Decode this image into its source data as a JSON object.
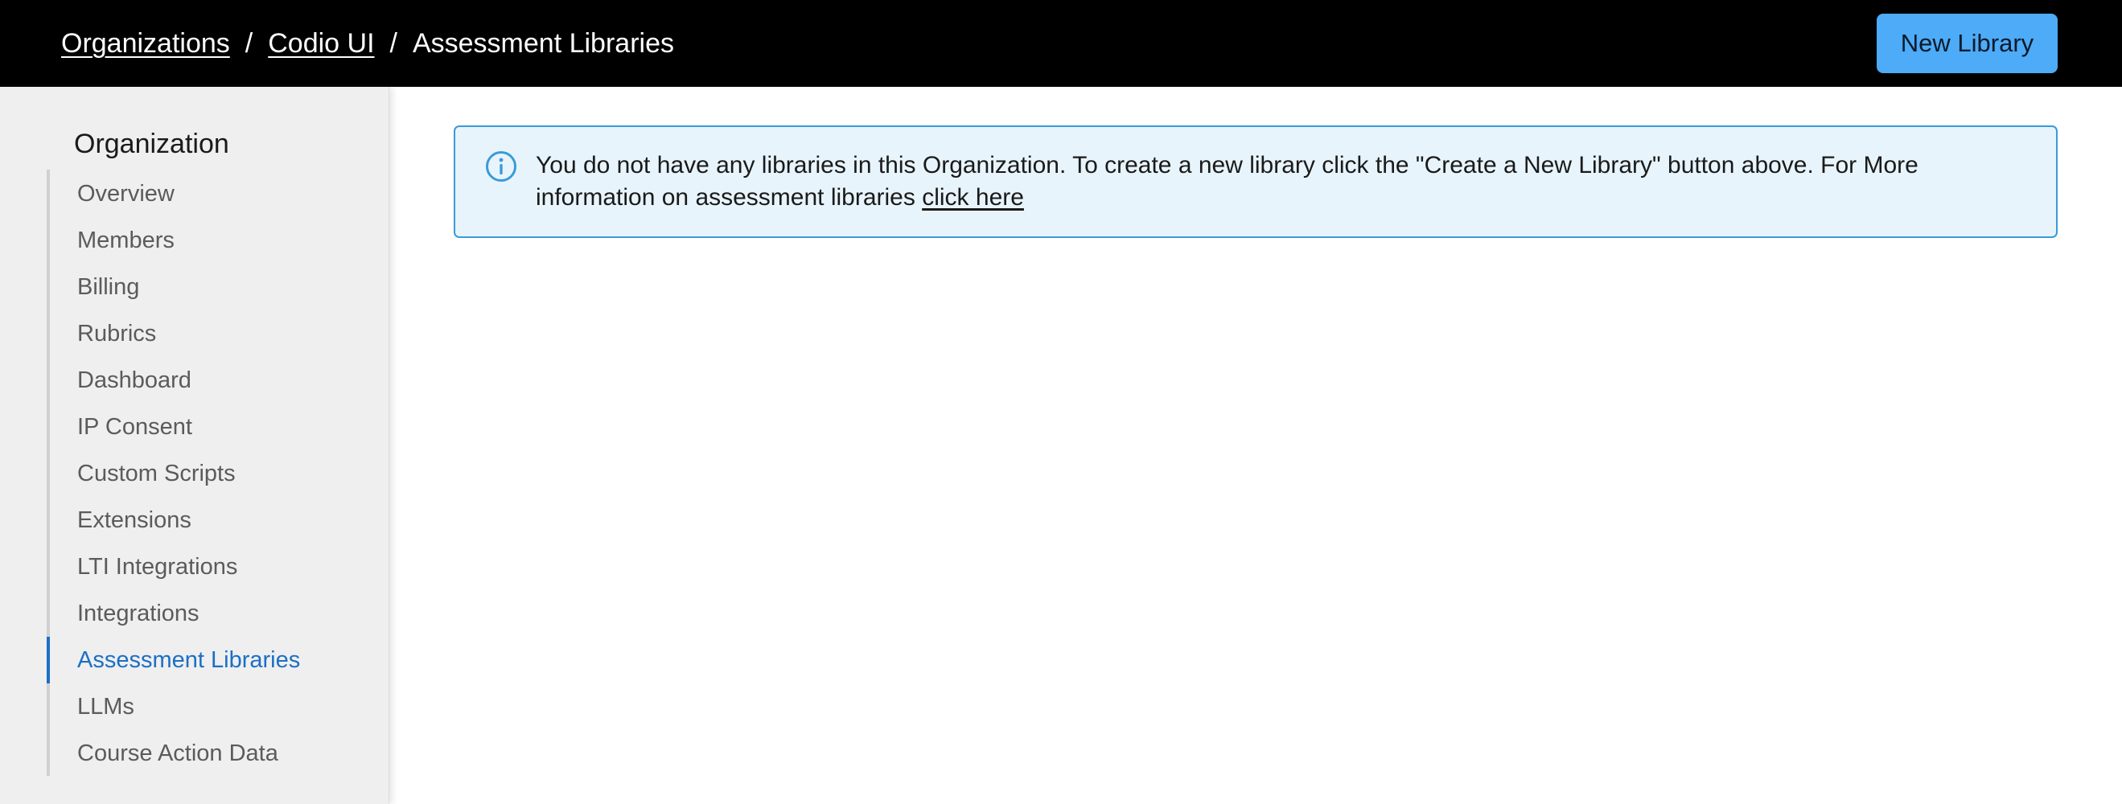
{
  "header": {
    "breadcrumb": {
      "organizations": "Organizations",
      "org_name": "Codio UI",
      "current": "Assessment Libraries",
      "separator": "/"
    },
    "new_library_label": "New Library"
  },
  "sidebar": {
    "heading": "Organization",
    "items": [
      {
        "label": "Overview",
        "active": false
      },
      {
        "label": "Members",
        "active": false
      },
      {
        "label": "Billing",
        "active": false
      },
      {
        "label": "Rubrics",
        "active": false
      },
      {
        "label": "Dashboard",
        "active": false
      },
      {
        "label": "IP Consent",
        "active": false
      },
      {
        "label": "Custom Scripts",
        "active": false
      },
      {
        "label": "Extensions",
        "active": false
      },
      {
        "label": "LTI Integrations",
        "active": false
      },
      {
        "label": "Integrations",
        "active": false
      },
      {
        "label": "Assessment Libraries",
        "active": true
      },
      {
        "label": "LLMs",
        "active": false
      },
      {
        "label": "Course Action Data",
        "active": false
      }
    ]
  },
  "alert": {
    "icon": "info-icon",
    "message": "You do not have any libraries in this Organization. To create a new library click the \"Create a New Library\" button above. For More information on assessment libraries ",
    "link_label": "click here"
  },
  "colors": {
    "topbar": "#000000",
    "primary_button": "#4dabf7",
    "active_nav": "#1c6fc4",
    "alert_bg": "#e8f4fc",
    "alert_border": "#3b9ad9"
  }
}
